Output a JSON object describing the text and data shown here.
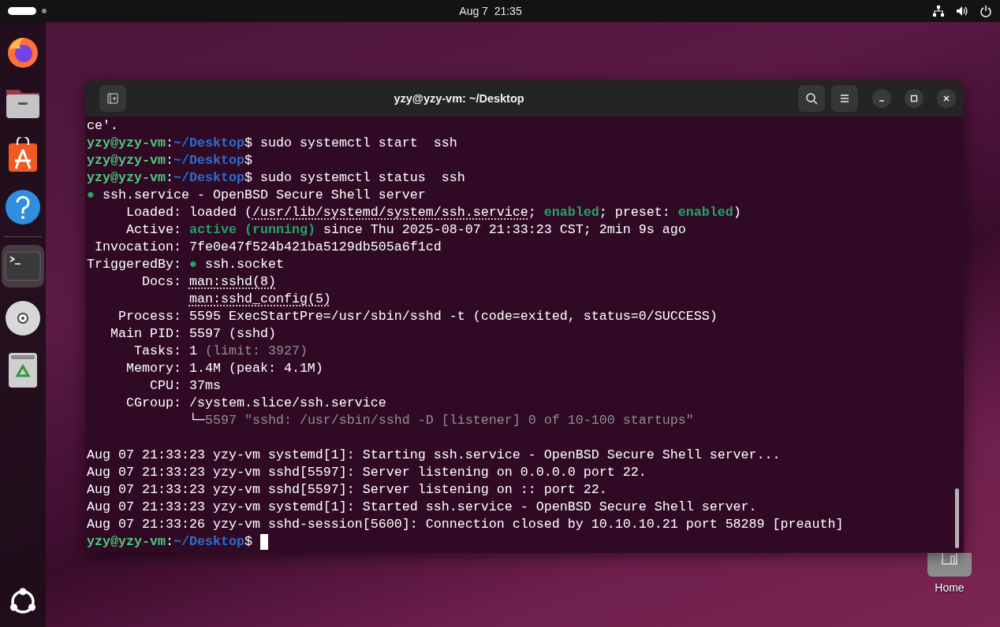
{
  "topbar": {
    "clock": "Aug 7  21:35"
  },
  "dock": {
    "apps": [
      {
        "kind": "firefox",
        "selected": false
      },
      {
        "kind": "files",
        "selected": false
      },
      {
        "kind": "store",
        "selected": false
      },
      {
        "kind": "help",
        "selected": false
      },
      {
        "kind": "separator"
      },
      {
        "kind": "terminal",
        "selected": true
      },
      {
        "kind": "disc",
        "selected": false
      },
      {
        "kind": "trash",
        "selected": false
      }
    ]
  },
  "desktop_icons": [
    {
      "label": "Home"
    }
  ],
  "terminal": {
    "title": "yzy@yzy-vm: ~/Desktop",
    "lines": [
      {
        "cursor": false,
        "segments": [
          {
            "kind": "plain",
            "text": "ce'."
          }
        ]
      },
      {
        "cursor": false,
        "segments": [
          {
            "kind": "user",
            "text": "yzy@yzy-vm"
          },
          {
            "kind": "plain",
            "text": ":"
          },
          {
            "kind": "path",
            "text": "~/Desktop"
          },
          {
            "kind": "plain",
            "text": "$ sudo systemctl start  ssh"
          }
        ]
      },
      {
        "cursor": false,
        "segments": [
          {
            "kind": "user",
            "text": "yzy@yzy-vm"
          },
          {
            "kind": "plain",
            "text": ":"
          },
          {
            "kind": "path",
            "text": "~/Desktop"
          },
          {
            "kind": "plain",
            "text": "$"
          }
        ]
      },
      {
        "cursor": false,
        "segments": [
          {
            "kind": "user",
            "text": "yzy@yzy-vm"
          },
          {
            "kind": "plain",
            "text": ":"
          },
          {
            "kind": "path",
            "text": "~/Desktop"
          },
          {
            "kind": "plain",
            "text": "$ sudo systemctl status  ssh"
          }
        ]
      },
      {
        "cursor": false,
        "segments": [
          {
            "kind": "dot",
            "text": "●"
          },
          {
            "kind": "plain",
            "text": " ssh.service - OpenBSD Secure Shell server"
          }
        ]
      },
      {
        "cursor": false,
        "segments": [
          {
            "kind": "plain",
            "text": "     Loaded: loaded ("
          },
          {
            "kind": "link",
            "text": "/usr/lib/systemd/system/ssh.service"
          },
          {
            "kind": "plain",
            "text": "; "
          },
          {
            "kind": "green",
            "text": "enabled"
          },
          {
            "kind": "plain",
            "text": "; preset: "
          },
          {
            "kind": "green",
            "text": "enabled"
          },
          {
            "kind": "plain",
            "text": ")"
          }
        ]
      },
      {
        "cursor": false,
        "segments": [
          {
            "kind": "plain",
            "text": "     Active: "
          },
          {
            "kind": "green",
            "text": "active (running)"
          },
          {
            "kind": "plain",
            "text": " since Thu 2025-08-07 21:33:23 CST; 2min 9s ago"
          }
        ]
      },
      {
        "cursor": false,
        "segments": [
          {
            "kind": "plain",
            "text": " Invocation: 7fe0e47f524b421ba5129db505a6f1cd"
          }
        ]
      },
      {
        "cursor": false,
        "segments": [
          {
            "kind": "plain",
            "text": "TriggeredBy: "
          },
          {
            "kind": "dot",
            "text": "●"
          },
          {
            "kind": "plain",
            "text": " ssh.socket"
          }
        ]
      },
      {
        "cursor": false,
        "segments": [
          {
            "kind": "plain",
            "text": "       Docs: "
          },
          {
            "kind": "link",
            "text": "man:sshd(8)"
          }
        ]
      },
      {
        "cursor": false,
        "segments": [
          {
            "kind": "link",
            "text": "             man:sshd_config(5)"
          }
        ]
      },
      {
        "cursor": false,
        "segments": [
          {
            "kind": "plain",
            "text": "    Process: 5595 ExecStartPre=/usr/sbin/sshd -t (code=exited, status=0/SUCCESS)"
          }
        ]
      },
      {
        "cursor": false,
        "segments": [
          {
            "kind": "plain",
            "text": "   Main PID: 5597 (sshd)"
          }
        ]
      },
      {
        "cursor": false,
        "segments": [
          {
            "kind": "plain",
            "text": "      Tasks: 1"
          },
          {
            "kind": "dim",
            "text": " (limit: 3927)"
          }
        ]
      },
      {
        "cursor": false,
        "segments": [
          {
            "kind": "plain",
            "text": "     Memory: 1.4M (peak: 4.1M)"
          }
        ]
      },
      {
        "cursor": false,
        "segments": [
          {
            "kind": "plain",
            "text": "        CPU: 37ms"
          }
        ]
      },
      {
        "cursor": false,
        "segments": [
          {
            "kind": "plain",
            "text": "     CGroup: /system.slice/ssh.service"
          }
        ]
      },
      {
        "cursor": false,
        "segments": [
          {
            "kind": "plain",
            "text": "             └─"
          },
          {
            "kind": "dim",
            "text": "5597 \"sshd: /usr/sbin/sshd -D [listener] 0 of 10-100 startups\""
          }
        ]
      },
      {
        "cursor": false
      },
      {
        "cursor": false,
        "segments": [
          {
            "kind": "plain",
            "text": "Aug 07 21:33:23 yzy-vm systemd[1]: Starting ssh.service - OpenBSD Secure Shell server..."
          }
        ]
      },
      {
        "cursor": false,
        "segments": [
          {
            "kind": "plain",
            "text": "Aug 07 21:33:23 yzy-vm sshd[5597]: Server listening on 0.0.0.0 port 22."
          }
        ]
      },
      {
        "cursor": false,
        "segments": [
          {
            "kind": "plain",
            "text": "Aug 07 21:33:23 yzy-vm sshd[5597]: Server listening on :: port 22."
          }
        ]
      },
      {
        "cursor": false,
        "segments": [
          {
            "kind": "plain",
            "text": "Aug 07 21:33:23 yzy-vm systemd[1]: Started ssh.service - OpenBSD Secure Shell server."
          }
        ]
      },
      {
        "cursor": false,
        "segments": [
          {
            "kind": "plain",
            "text": "Aug 07 21:33:26 yzy-vm sshd-session[5600]: Connection closed by 10.10.10.21 port 58289 [preauth]"
          }
        ]
      },
      {
        "cursor": true,
        "segments": [
          {
            "kind": "user",
            "text": "yzy@yzy-vm"
          },
          {
            "kind": "plain",
            "text": ":"
          },
          {
            "kind": "path",
            "text": "~/Desktop"
          },
          {
            "kind": "plain",
            "text": "$ "
          }
        ]
      }
    ]
  }
}
